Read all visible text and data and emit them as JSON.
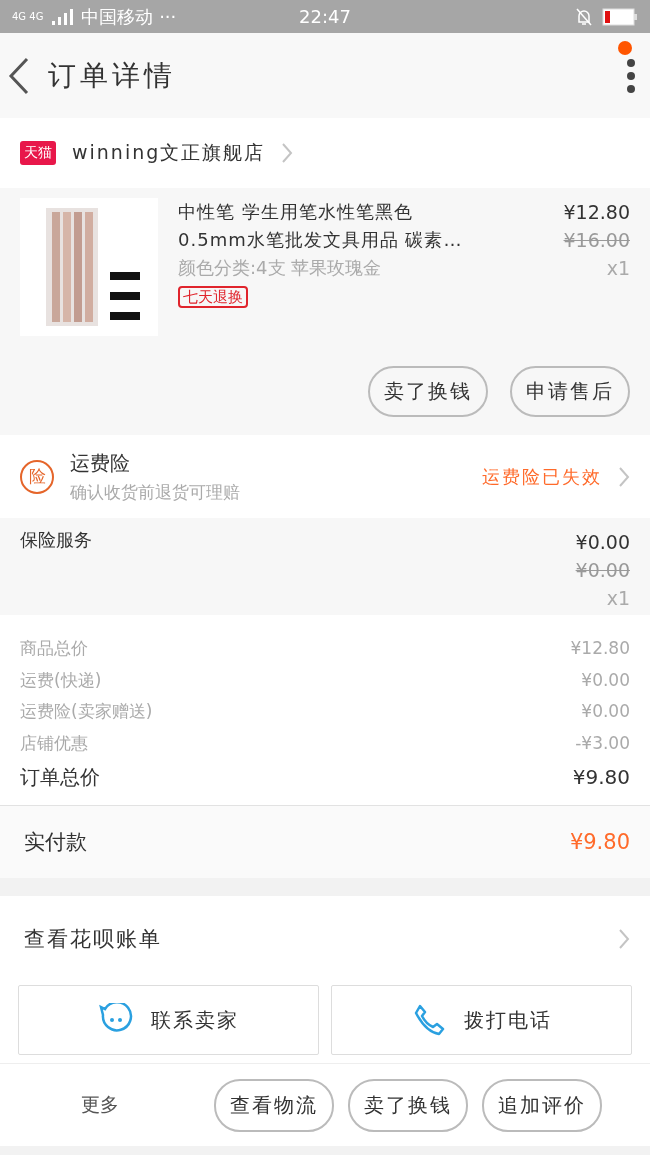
{
  "status_bar": {
    "network": "4G 4G",
    "carrier": "中国移动 ···",
    "time": "22:47"
  },
  "header": {
    "title": "订单详情",
    "notification_dot": true
  },
  "shop": {
    "badge": "天猫",
    "name": "winning文正旗舰店"
  },
  "product": {
    "title": "中性笔 学生用笔水性笔黑色 0.5mm水笔批发文具用品 碳素…",
    "variant": "颜色分类:4支 苹果玫瑰金",
    "tag": "七天退换",
    "price": "¥12.80",
    "original_price": "¥16.00",
    "quantity": "x1",
    "buttons": [
      "卖了换钱",
      "申请售后"
    ]
  },
  "shipping_insurance": {
    "icon_text": "险",
    "title": "运费险",
    "subtitle": "确认收货前退货可理赔",
    "status": "运费险已失效"
  },
  "insurance_service": {
    "label": "保险服务",
    "price": "¥0.00",
    "original_price": "¥0.00",
    "quantity": "x1"
  },
  "totals": [
    {
      "label": "商品总价",
      "value": "¥12.80",
      "kind": "line"
    },
    {
      "label": "运费(快递)",
      "value": "¥0.00",
      "kind": "line"
    },
    {
      "label": "运费险(卖家赠送)",
      "value": "¥0.00",
      "kind": "line"
    },
    {
      "label": "店铺优惠",
      "value": "-¥3.00",
      "kind": "line"
    },
    {
      "label": "订单总价",
      "value": "¥9.80",
      "kind": "total"
    }
  ],
  "paid": {
    "label": "实付款",
    "value": "¥9.80"
  },
  "huabei": {
    "label": "查看花呗账单"
  },
  "contact_buttons": [
    {
      "label": "联系卖家",
      "kind": "chat"
    },
    {
      "label": "拨打电话",
      "kind": "phone"
    }
  ],
  "bottom_bar": {
    "more": "更多",
    "buttons": [
      "查看物流",
      "卖了换钱",
      "追加评价"
    ]
  }
}
